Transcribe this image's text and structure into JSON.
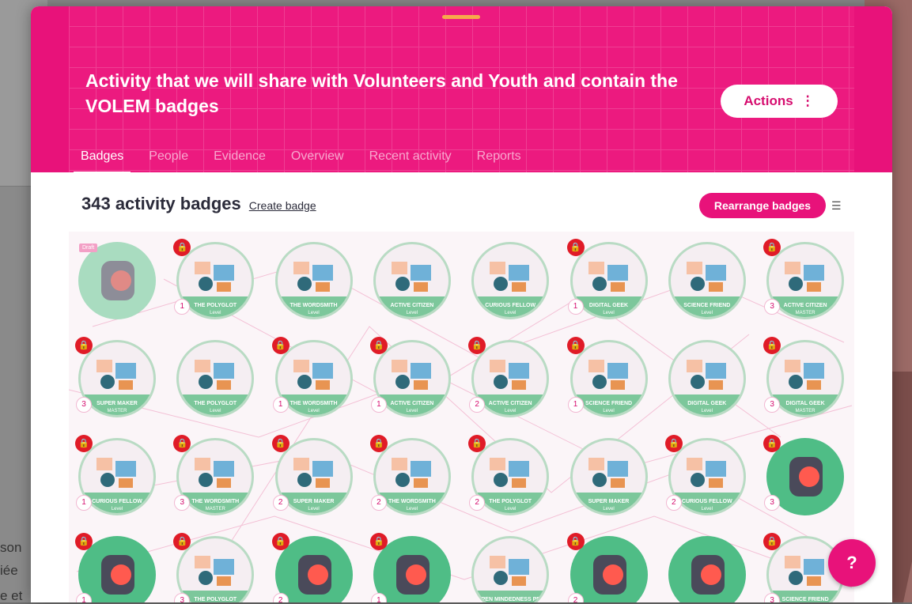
{
  "background": {
    "text_lines": [
      "son",
      "iée",
      "e et"
    ]
  },
  "header": {
    "title": "Activity that we will share with Volunteers and Youth and contain the VOLEM badges",
    "actions_label": "Actions",
    "actions_icon": "more-vertical-icon",
    "accent_color": "#e8127a"
  },
  "tabs": [
    {
      "label": "Badges",
      "active": true
    },
    {
      "label": "People",
      "active": false
    },
    {
      "label": "Evidence",
      "active": false
    },
    {
      "label": "Overview",
      "active": false
    },
    {
      "label": "Recent activity",
      "active": false
    },
    {
      "label": "Reports",
      "active": false
    }
  ],
  "badges_section": {
    "title": "343 activity badges",
    "create_label": "Create badge",
    "rearrange_label": "Rearrange badges",
    "view_icon": "list-view-icon"
  },
  "badges": [
    {
      "row": 0,
      "col": 0,
      "type": "logo",
      "pale": true,
      "draft": "Draft",
      "locked": false,
      "level": ""
    },
    {
      "row": 0,
      "col": 1,
      "type": "art",
      "name": "THE POLYGLOT",
      "caption": "Level",
      "locked": true,
      "level": "1"
    },
    {
      "row": 0,
      "col": 2,
      "type": "art",
      "name": "THE WORDSMITH",
      "caption": "Level",
      "locked": false,
      "level": ""
    },
    {
      "row": 0,
      "col": 3,
      "type": "art",
      "name": "ACTIVE CITIZEN",
      "caption": "Level",
      "locked": false,
      "level": ""
    },
    {
      "row": 0,
      "col": 4,
      "type": "art",
      "name": "CURIOUS FELLOW",
      "caption": "Level",
      "locked": false,
      "level": ""
    },
    {
      "row": 0,
      "col": 5,
      "type": "art",
      "name": "DIGITAL GEEK",
      "caption": "Level",
      "locked": true,
      "level": "1"
    },
    {
      "row": 0,
      "col": 6,
      "type": "art",
      "name": "SCIENCE FRIEND",
      "caption": "Level",
      "locked": false,
      "level": ""
    },
    {
      "row": 0,
      "col": 7,
      "type": "art",
      "name": "ACTIVE CITIZEN",
      "caption": "MASTER",
      "locked": true,
      "level": "3"
    },
    {
      "row": 1,
      "col": 0,
      "type": "art",
      "name": "SUPER MAKER",
      "caption": "MASTER",
      "locked": true,
      "level": "3"
    },
    {
      "row": 1,
      "col": 1,
      "type": "art",
      "name": "THE POLYGLOT",
      "caption": "Level",
      "locked": false,
      "level": ""
    },
    {
      "row": 1,
      "col": 2,
      "type": "art",
      "name": "THE WORDSMITH",
      "caption": "Level",
      "locked": true,
      "level": "1"
    },
    {
      "row": 1,
      "col": 3,
      "type": "art",
      "name": "ACTIVE CITIZEN",
      "caption": "Level",
      "locked": true,
      "level": "1"
    },
    {
      "row": 1,
      "col": 4,
      "type": "art",
      "name": "ACTIVE CITIZEN",
      "caption": "Level",
      "locked": true,
      "level": "2"
    },
    {
      "row": 1,
      "col": 5,
      "type": "art",
      "name": "SCIENCE FRIEND",
      "caption": "Level",
      "locked": true,
      "level": "1"
    },
    {
      "row": 1,
      "col": 6,
      "type": "art",
      "name": "DIGITAL GEEK",
      "caption": "Level",
      "locked": false,
      "level": ""
    },
    {
      "row": 1,
      "col": 7,
      "type": "art",
      "name": "DIGITAL GEEK",
      "caption": "MASTER",
      "locked": true,
      "level": "3"
    },
    {
      "row": 2,
      "col": 0,
      "type": "art",
      "name": "CURIOUS FELLOW",
      "caption": "Level",
      "locked": true,
      "level": "1"
    },
    {
      "row": 2,
      "col": 1,
      "type": "art",
      "name": "THE WORDSMITH",
      "caption": "MASTER",
      "locked": true,
      "level": "3"
    },
    {
      "row": 2,
      "col": 2,
      "type": "art",
      "name": "SUPER MAKER",
      "caption": "Level",
      "locked": true,
      "level": "2"
    },
    {
      "row": 2,
      "col": 3,
      "type": "art",
      "name": "THE WORDSMITH",
      "caption": "Level",
      "locked": true,
      "level": "2"
    },
    {
      "row": 2,
      "col": 4,
      "type": "art",
      "name": "THE POLYGLOT",
      "caption": "Level",
      "locked": true,
      "level": "2"
    },
    {
      "row": 2,
      "col": 5,
      "type": "art",
      "name": "SUPER MAKER",
      "caption": "Level",
      "locked": false,
      "level": ""
    },
    {
      "row": 2,
      "col": 6,
      "type": "art",
      "name": "CURIOUS FELLOW",
      "caption": "Level",
      "locked": true,
      "level": "2"
    },
    {
      "row": 2,
      "col": 7,
      "type": "logo",
      "pale": false,
      "locked": true,
      "level": "3"
    },
    {
      "row": 3,
      "col": 0,
      "type": "logo",
      "pale": false,
      "locked": true,
      "level": "1"
    },
    {
      "row": 3,
      "col": 1,
      "type": "art",
      "name": "THE POLYGLOT",
      "caption": "",
      "locked": true,
      "level": "3"
    },
    {
      "row": 3,
      "col": 2,
      "type": "logo",
      "pale": false,
      "locked": true,
      "level": "2"
    },
    {
      "row": 3,
      "col": 3,
      "type": "logo",
      "pale": false,
      "locked": true,
      "level": "1"
    },
    {
      "row": 3,
      "col": 4,
      "type": "art",
      "name": "OPEN MINDEDNESS PROMOTER",
      "caption": "",
      "locked": false,
      "level": ""
    },
    {
      "row": 3,
      "col": 5,
      "type": "logo",
      "pale": false,
      "locked": true,
      "level": "2"
    },
    {
      "row": 3,
      "col": 6,
      "type": "logo",
      "pale": false,
      "locked": false,
      "level": ""
    },
    {
      "row": 3,
      "col": 7,
      "type": "art",
      "name": "SCIENCE FRIEND",
      "caption": "",
      "locked": true,
      "level": "3"
    }
  ],
  "icons": {
    "lock": "lock-icon",
    "help": "help-icon"
  },
  "help_label": "?"
}
